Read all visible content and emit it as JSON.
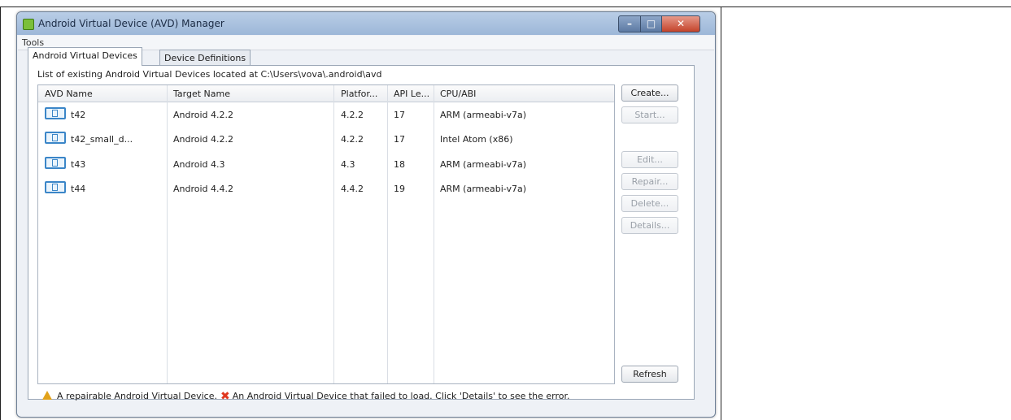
{
  "window": {
    "title": "Android Virtual Device (AVD) Manager"
  },
  "menu": {
    "tools": "Tools"
  },
  "tabs": [
    "Android Virtual Devices",
    "Device Definitions"
  ],
  "caption": "List of existing Android Virtual Devices located at C:\\Users\\vova\\.android\\avd",
  "table": {
    "headers": [
      "AVD Name",
      "Target Name",
      "Platfor...",
      "API Le...",
      "CPU/ABI"
    ],
    "rows": [
      [
        "t42",
        "Android 4.2.2",
        "4.2.2",
        "17",
        "ARM (armeabi-v7a)"
      ],
      [
        "t42_small_d...",
        "Android 4.2.2",
        "4.2.2",
        "17",
        "Intel Atom (x86)"
      ],
      [
        "t43",
        "Android 4.3",
        "4.3",
        "18",
        "ARM (armeabi-v7a)"
      ],
      [
        "t44",
        "Android 4.4.2",
        "4.4.2",
        "19",
        "ARM (armeabi-v7a)"
      ]
    ]
  },
  "buttons": {
    "create": "Create...",
    "start": "Start...",
    "edit": "Edit...",
    "repair": "Repair...",
    "delete": "Delete...",
    "details": "Details...",
    "refresh": "Refresh"
  },
  "legend": {
    "repairable": "A repairable Android Virtual Device.",
    "failed": "An Android Virtual Device that failed to load. Click 'Details' to see the error."
  },
  "icons": {
    "app": "android-icon",
    "device": "device-icon",
    "warning": "warning-icon",
    "error": "error-x-icon"
  },
  "colors": {
    "titlebar": "#9db7d8",
    "close": "#c4432a",
    "warning": "#e2a21a",
    "error": "#e0371f",
    "device_icon": "#3b86c8"
  }
}
